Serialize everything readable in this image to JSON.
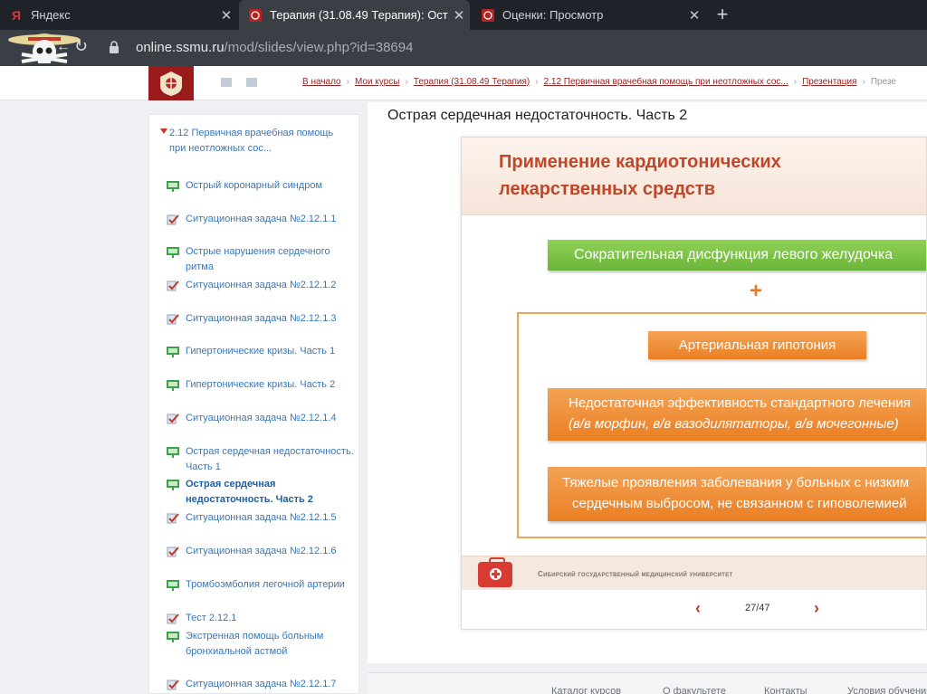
{
  "browser": {
    "tabs": [
      {
        "title": "Яндекс",
        "favicon": "Я",
        "active": false
      },
      {
        "title": "Терапия (31.08.49 Терапия): Ост",
        "favicon": "crest",
        "active": true
      },
      {
        "title": "Оценки: Просмотр",
        "favicon": "crest",
        "active": false
      }
    ],
    "new_tab": "+",
    "close_glyph": "✕",
    "url_host": "online.ssmu.ru",
    "url_path": "/mod/slides/view.php?id=38694"
  },
  "header": {
    "breadcrumb": [
      "В начало",
      "Мои курсы",
      "Терапия (31.08.49 Терапия)",
      "2.12 Первичная врачебная помощь при неотложных сос...",
      "Презентация"
    ],
    "breadcrumb_tail": "Презе",
    "separator": "›"
  },
  "nav": {
    "parent": "2.12 Первичная врачебная помощь при неотложных сос...",
    "items": [
      {
        "label": "Острый коронарный синдром",
        "type": "slides"
      },
      {
        "label": "Ситуационная задача №2.12.1.1",
        "type": "quiz"
      },
      {
        "label": "Острые нарушения сердечного ритма",
        "type": "slides"
      },
      {
        "label": "Ситуационная задача №2.12.1.2",
        "type": "quiz"
      },
      {
        "label": "Ситуационная задача №2.12.1.3",
        "type": "quiz"
      },
      {
        "label": "Гипертонические кризы. Часть 1",
        "type": "slides"
      },
      {
        "label": "Гипертонические кризы. Часть 2",
        "type": "slides"
      },
      {
        "label": "Ситуационная задача №2.12.1.4",
        "type": "quiz"
      },
      {
        "label": "Острая сердечная недостаточность. Часть 1",
        "type": "slides"
      },
      {
        "label": "Острая сердечная недостаточность. Часть 2",
        "type": "slides",
        "current": true
      },
      {
        "label": "Ситуационная задача №2.12.1.5",
        "type": "quiz"
      },
      {
        "label": "Ситуационная задача №2.12.1.6",
        "type": "quiz"
      },
      {
        "label": "Тромбоэмболия легочной артерии",
        "type": "slides"
      },
      {
        "label": "Тест 2.12.1",
        "type": "quiz"
      },
      {
        "label": "Экстренная помощь больным бронхиальной астмой",
        "type": "slides"
      },
      {
        "label": "Ситуационная задача №2.12.1.7",
        "type": "quiz"
      }
    ]
  },
  "main": {
    "title": "Острая сердечная недостаточность. Часть 2",
    "slide": {
      "title_line1": "Применение кардиотонических",
      "title_line2": "лекарственных средств",
      "green": "Сократительная дисфункция левого желудочка",
      "plus": "+",
      "box1": "Артериальная гипотония",
      "box2_line1": "Недостаточная эффективность стандартного лечения",
      "box2_line2": "(в/в морфин, в/в вазодилятаторы, в/в мочегонные)",
      "box3_line1": "Тяжелые проявления заболевания у больных с низким",
      "box3_line2": "сердечным выбросом, не связанном с гиповолемией",
      "university": "Сибирский государственный медицинский университет"
    },
    "pager": {
      "prev": "‹",
      "current": "27/47",
      "next": "›"
    }
  },
  "footer": {
    "links": [
      "Каталог курсов",
      "О факультете",
      "Контакты",
      "Условия обучения"
    ]
  },
  "colors": {
    "accent_red": "#9b1b1b",
    "link_blue": "#3a77b5",
    "slide_orange": "#ea7f24",
    "slide_green": "#6cb43a"
  }
}
